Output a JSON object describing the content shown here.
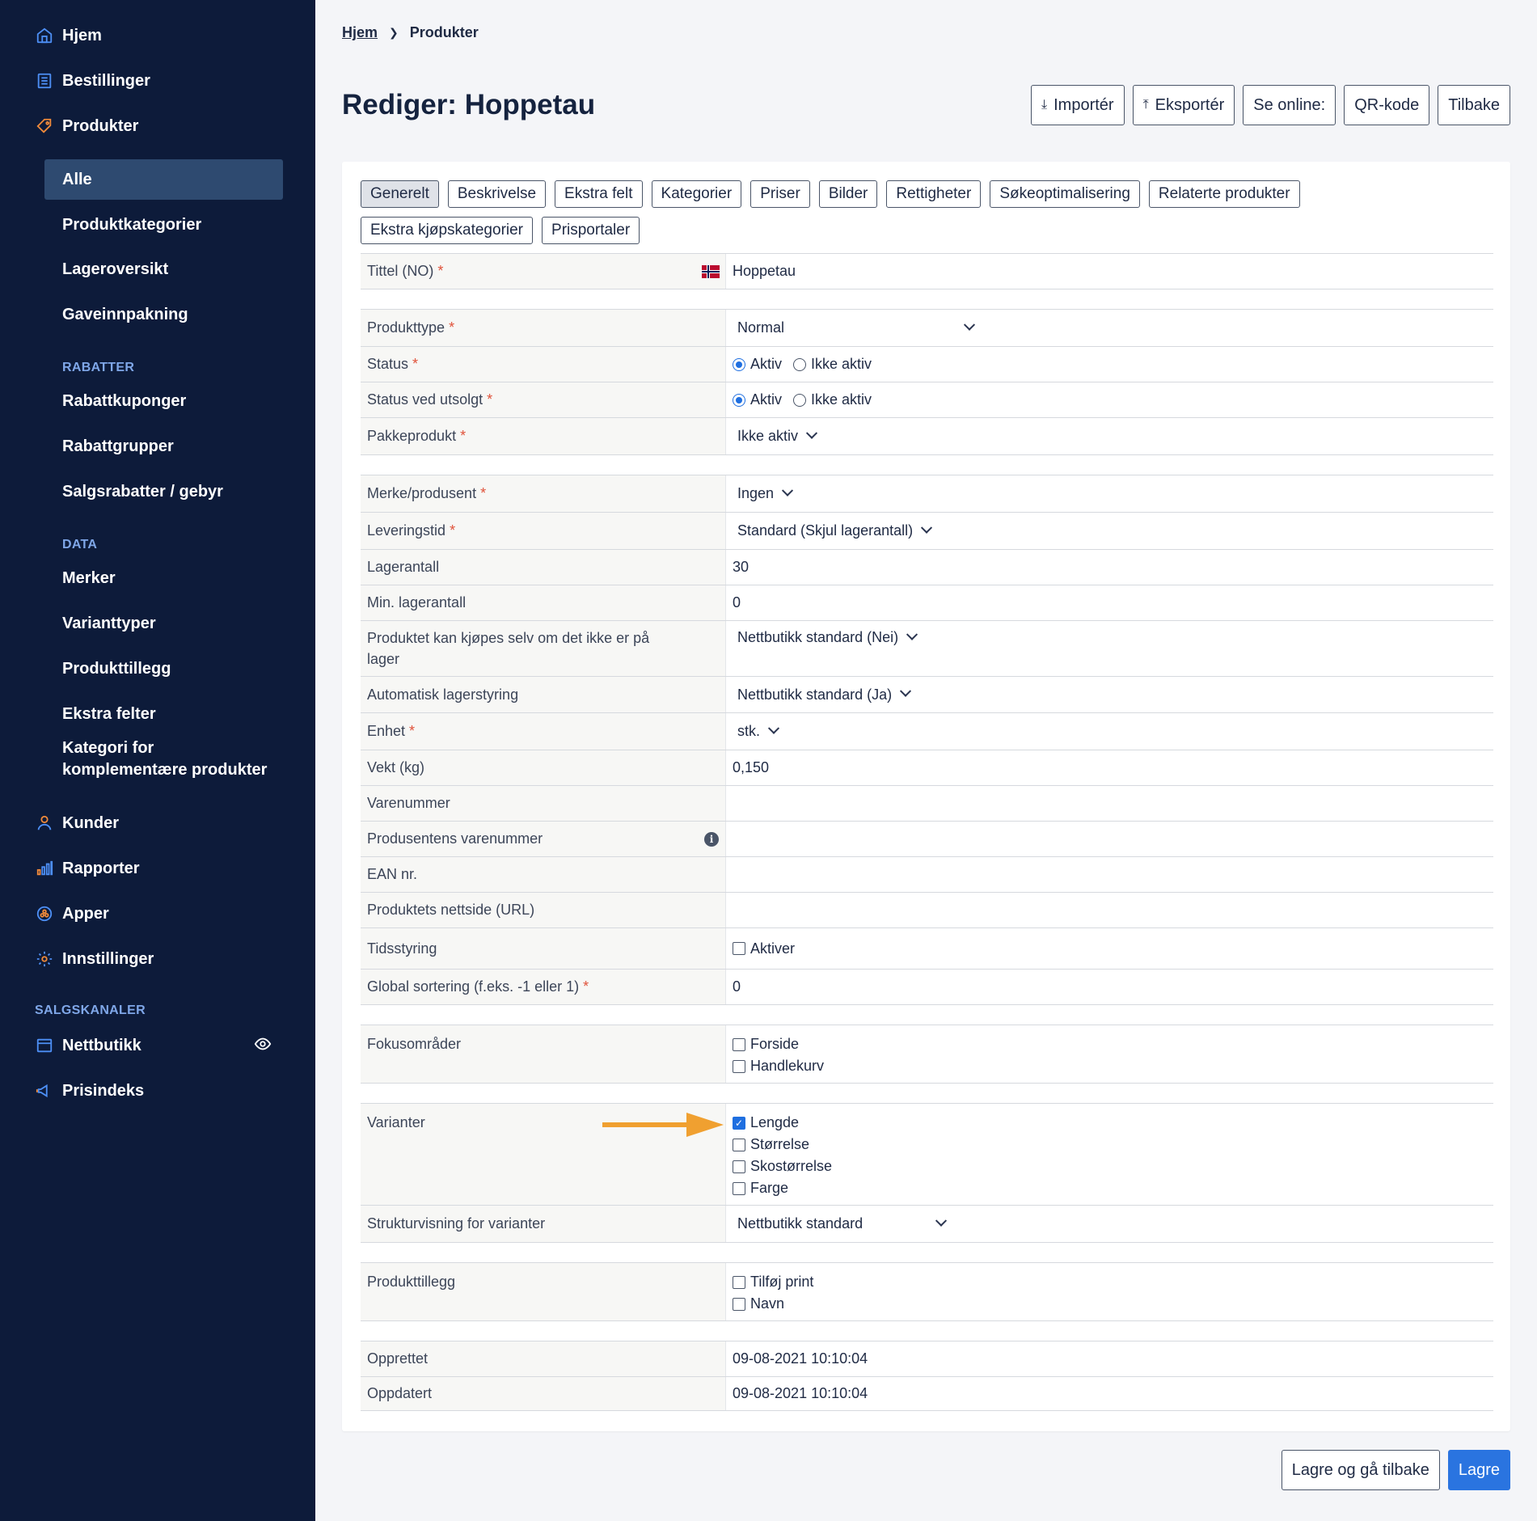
{
  "sidebar": {
    "items": [
      {
        "label": "Hjem",
        "icon": "home-icon"
      },
      {
        "label": "Bestillinger",
        "icon": "orders-icon"
      },
      {
        "label": "Produkter",
        "icon": "tag-icon"
      }
    ],
    "produkter_sub": [
      "Alle",
      "Produktkategorier",
      "Lageroversikt",
      "Gaveinnpakning"
    ],
    "section_rabatter": "RABATTER",
    "rabatter_sub": [
      "Rabattkuponger",
      "Rabattgrupper",
      "Salgsrabatter / gebyr"
    ],
    "section_data": "DATA",
    "data_sub": [
      "Merker",
      "Varianttyper",
      "Produkttillegg",
      "Ekstra felter",
      "Kategori for",
      "komplementære produkter"
    ],
    "items2": [
      {
        "label": "Kunder",
        "icon": "user-icon"
      },
      {
        "label": "Rapporter",
        "icon": "bar-chart-icon"
      },
      {
        "label": "Apper",
        "icon": "apps-icon"
      },
      {
        "label": "Innstillinger",
        "icon": "gear-icon"
      }
    ],
    "section_salgskanaler": "SALGSKANALER",
    "items3": [
      {
        "label": "Nettbutikk",
        "icon": "store-icon"
      },
      {
        "label": "Prisindeks",
        "icon": "megaphone-icon"
      }
    ],
    "accent_color": "#7fa7e8",
    "active_bg": "#2e4a70"
  },
  "breadcrumb": {
    "home": "Hjem",
    "current": "Produkter"
  },
  "page_title": "Rediger: Hoppetau",
  "top_actions": [
    "Importér",
    "Eksportér",
    "Se online:",
    "QR-kode",
    "Tilbake"
  ],
  "tabs_row1": [
    "Generelt",
    "Beskrivelse",
    "Ekstra felt",
    "Kategorier",
    "Priser",
    "Bilder",
    "Rettigheter",
    "Søkeoptimalisering",
    "Relaterte produkter"
  ],
  "tabs_row2": [
    "Ekstra kjøpskategorier",
    "Prisportaler"
  ],
  "form": {
    "tittel": {
      "label": "Tittel (NO)",
      "value": "Hoppetau"
    },
    "produkttype": {
      "label": "Produkttype",
      "value": "Normal"
    },
    "status": {
      "label": "Status",
      "opt1": "Aktiv",
      "opt2": "Ikke aktiv"
    },
    "status_utsolgt": {
      "label": "Status ved utsolgt",
      "opt1": "Aktiv",
      "opt2": "Ikke aktiv"
    },
    "pakkeprodukt": {
      "label": "Pakkeprodukt",
      "value": "Ikke aktiv"
    },
    "merke": {
      "label": "Merke/produsent",
      "value": "Ingen"
    },
    "leveringstid": {
      "label": "Leveringstid",
      "value": "Standard (Skjul lagerantall)"
    },
    "lagerantall": {
      "label": "Lagerantall",
      "value": "30"
    },
    "min_lager": {
      "label": "Min. lagerantall",
      "value": "0"
    },
    "kjopes_uten_lager": {
      "label_l1": "Produktet kan kjøpes selv om det ikke er på",
      "label_l2": "lager",
      "value": "Nettbutikk standard (Nei)"
    },
    "auto_lager": {
      "label": "Automatisk lagerstyring",
      "value": "Nettbutikk standard (Ja)"
    },
    "enhet": {
      "label": "Enhet",
      "value": "stk."
    },
    "vekt": {
      "label": "Vekt (kg)",
      "value": "0,150"
    },
    "varenummer": {
      "label": "Varenummer"
    },
    "prod_varenummer": {
      "label": "Produsentens varenummer"
    },
    "ean": {
      "label": "EAN nr."
    },
    "nettside": {
      "label": "Produktets nettside (URL)"
    },
    "tidsstyring": {
      "label": "Tidsstyring",
      "option": "Aktiver"
    },
    "global_sort": {
      "label": "Global sortering (f.eks. -1 eller 1)",
      "value": "0"
    },
    "fokus": {
      "label": "Fokusområder",
      "options": [
        "Forside",
        "Handlekurv"
      ]
    },
    "varianter": {
      "label": "Varianter",
      "options": [
        "Lengde",
        "Størrelse",
        "Skostørrelse",
        "Farge"
      ],
      "checked": "Lengde"
    },
    "strukturvisning": {
      "label": "Strukturvisning for varianter",
      "value": "Nettbutikk standard"
    },
    "produkttillegg": {
      "label": "Produkttillegg",
      "options": [
        "Tilføj print",
        "Navn"
      ]
    },
    "opprettet": {
      "label": "Opprettet",
      "value": "09-08-2021 10:10:04"
    },
    "oppdatert": {
      "label": "Oppdatert",
      "value": "09-08-2021 10:10:04"
    }
  },
  "bottom_actions": {
    "save_back": "Lagre og gå tilbake",
    "save": "Lagre"
  },
  "colors": {
    "primary": "#2a74e0",
    "arrow": "#f0a030",
    "required": "#e0523a"
  }
}
